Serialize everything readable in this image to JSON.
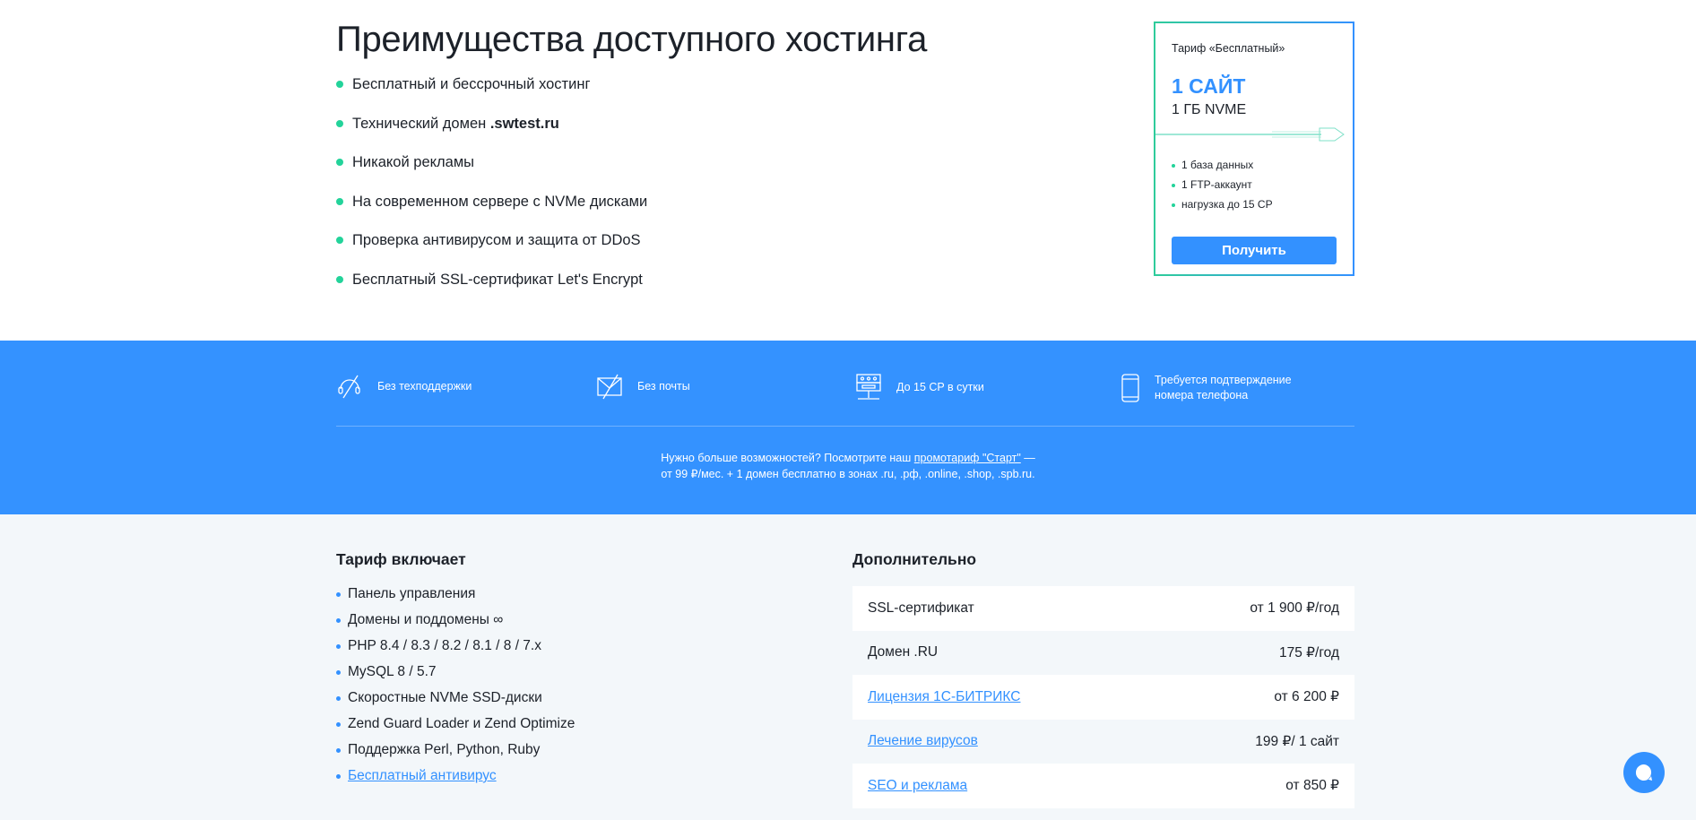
{
  "advantages": {
    "title": "Преимущества доступного хостинга",
    "items": [
      "Бесплатный и бессрочный хостинг",
      "Технический домен ",
      ".swtest.ru",
      "Никакой рекламы",
      "На современном сервере с NVMe дисками",
      "Проверка антивирусом и защита от DDoS",
      "Бесплатный SSL-сертификат Let's Encrypt"
    ]
  },
  "card": {
    "tariff": "Тариф «Бесплатный»",
    "sites": "1 САЙТ",
    "disk": "1 ГБ NVME",
    "features": [
      "1 база данных",
      "1 FTP-аккаунт",
      "нагрузка до 15 CP"
    ],
    "button": "Получить"
  },
  "band": {
    "features": [
      "Без техподдержки",
      "Без почты",
      "До 15 CP в сутки",
      "Требуется подтверждение",
      "номера телефона"
    ],
    "more_text": "Нужно больше возможностей? Посмотрите наш ",
    "more_link": "промотариф \"Старт\"",
    "more_text2": " —",
    "more_line2": "от 99 ₽/мес. + 1 домен бесплатно в зонах .ru, .рф, .online, .shop, .spb.ru."
  },
  "includes": {
    "title": "Тариф включает",
    "items": [
      "Панель управления",
      "Домены и поддомены ∞",
      "PHP 8.4 / 8.3 / 8.2 / 8.1 / 8 / 7.x",
      "MySQL 8 / 5.7",
      "Скоростные NVMe SSD-диски",
      "Zend Guard Loader и Zend Optimize",
      "Поддержка Perl, Python, Ruby",
      "Бесплатный антивирус"
    ]
  },
  "extra": {
    "title": "Дополнительно",
    "rows": [
      {
        "name": "SSL-сертификат",
        "price": "от 1 900 ₽/год"
      },
      {
        "name": "Домен .RU",
        "price": "175 ₽/год"
      },
      {
        "name": "Лицензия 1С-БИТРИКС",
        "price": "от 6 200 ₽"
      },
      {
        "name": "Лечение вирусов",
        "price": "199 ₽/ 1 сайт"
      },
      {
        "name": "SEO и реклама",
        "price": "от 850 ₽"
      }
    ]
  }
}
